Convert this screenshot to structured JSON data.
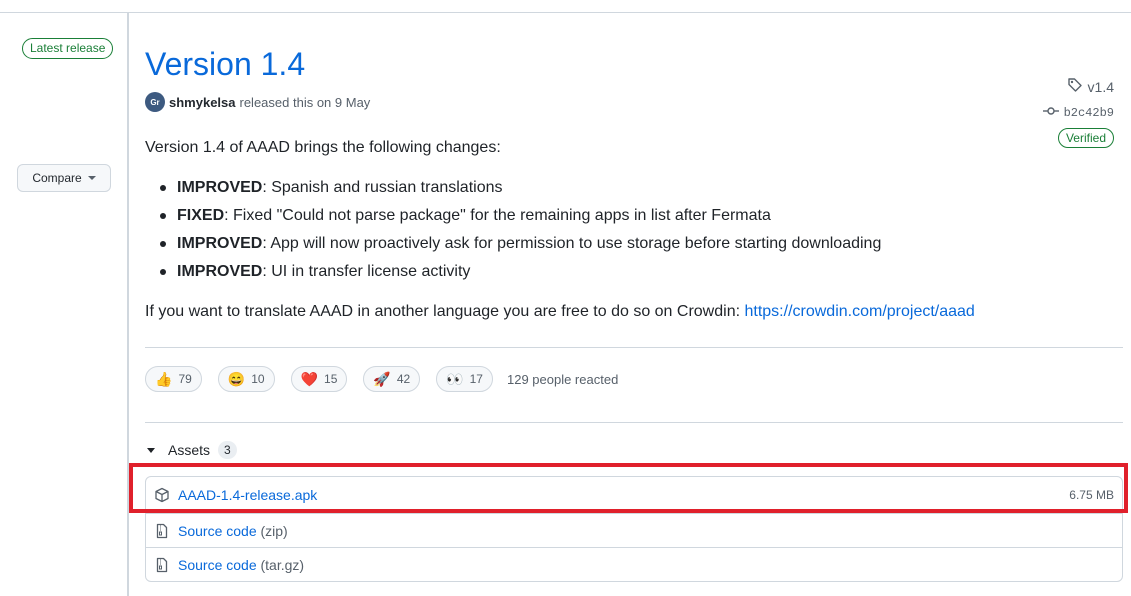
{
  "sidebar": {
    "latest_badge": "Latest release",
    "tag": "v1.4",
    "commit": "b2c42b9",
    "verified": "Verified",
    "compare_label": "Compare"
  },
  "release": {
    "title": "Version 1.4",
    "author": "shmykelsa",
    "released_text": "released this on 9 May",
    "avatar_text": "Gr",
    "intro": "Version 1.4 of AAAD brings the following changes:",
    "changes": [
      {
        "tag": "IMPROVED",
        "text": ": Spanish and russian translations"
      },
      {
        "tag": "FIXED",
        "text": ": Fixed \"Could not parse package\" for the remaining apps in list after Fermata"
      },
      {
        "tag": "IMPROVED",
        "text": ": App will now proactively ask for permission to use storage before starting downloading"
      },
      {
        "tag": "IMPROVED",
        "text": ": UI in transfer license activity"
      }
    ],
    "translate_text": "If you want to translate AAAD in another language you are free to do so on Crowdin: ",
    "translate_link": "https://crowdin.com/project/aaad"
  },
  "reactions": {
    "items": [
      {
        "icon": "thumbs-up-icon",
        "emoji": "👍",
        "count": "79"
      },
      {
        "icon": "laugh-icon",
        "emoji": "😄",
        "count": "10"
      },
      {
        "icon": "heart-icon",
        "emoji": "❤️",
        "count": "15"
      },
      {
        "icon": "rocket-icon",
        "emoji": "🚀",
        "count": "42"
      },
      {
        "icon": "eyes-icon",
        "emoji": "👀",
        "count": "17"
      }
    ],
    "summary": "129 people reacted"
  },
  "assets": {
    "label": "Assets",
    "count": "3",
    "items": [
      {
        "name": "AAAD-1.4-release.apk",
        "suffix": "",
        "size": "6.75 MB",
        "icon": "package-icon"
      },
      {
        "name": "Source code",
        "suffix": " (zip)",
        "size": "",
        "icon": "file-zip-icon"
      },
      {
        "name": "Source code",
        "suffix": " (tar.gz)",
        "size": "",
        "icon": "file-zip-icon"
      }
    ]
  },
  "colors": {
    "accent": "#0969da",
    "success": "#1a7f37",
    "highlight": "#e0202b"
  }
}
